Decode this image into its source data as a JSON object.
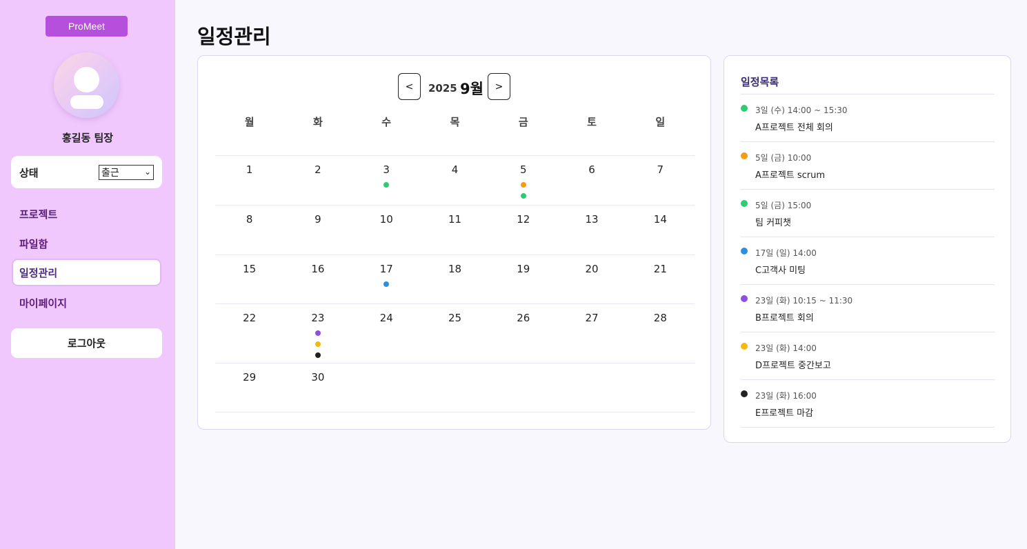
{
  "app": {
    "brand": "ProMeet"
  },
  "sidebar": {
    "user_name": "홍길동 팀장",
    "status": {
      "label": "상태",
      "selected": "출근"
    },
    "nav": [
      {
        "label": "프로젝트",
        "active": false
      },
      {
        "label": "파일함",
        "active": false
      },
      {
        "label": "일정관리",
        "active": true
      },
      {
        "label": "마이페이지",
        "active": false
      }
    ],
    "logout_label": "로그아웃"
  },
  "page": {
    "title": "일정관리"
  },
  "calendar": {
    "prev_label": "<",
    "next_label": ">",
    "year": "2025",
    "month": "9월",
    "weekdays": [
      "월",
      "화",
      "수",
      "목",
      "금",
      "토",
      "일"
    ],
    "weeks": [
      [
        {
          "day": "1",
          "dots": []
        },
        {
          "day": "2",
          "dots": []
        },
        {
          "day": "3",
          "dots": [
            "#2ecc71"
          ]
        },
        {
          "day": "4",
          "dots": []
        },
        {
          "day": "5",
          "dots": [
            "#f39c12",
            "#2ecc71"
          ]
        },
        {
          "day": "6",
          "dots": []
        },
        {
          "day": "7",
          "dots": []
        }
      ],
      [
        {
          "day": "8",
          "dots": []
        },
        {
          "day": "9",
          "dots": []
        },
        {
          "day": "10",
          "dots": []
        },
        {
          "day": "11",
          "dots": []
        },
        {
          "day": "12",
          "dots": []
        },
        {
          "day": "13",
          "dots": []
        },
        {
          "day": "14",
          "dots": []
        }
      ],
      [
        {
          "day": "15",
          "dots": []
        },
        {
          "day": "16",
          "dots": []
        },
        {
          "day": "17",
          "dots": [
            "#2d8fe0"
          ]
        },
        {
          "day": "18",
          "dots": []
        },
        {
          "day": "19",
          "dots": []
        },
        {
          "day": "20",
          "dots": []
        },
        {
          "day": "21",
          "dots": []
        }
      ],
      [
        {
          "day": "22",
          "dots": []
        },
        {
          "day": "23",
          "dots": [
            "#8e4fe0",
            "#f5b80c",
            "#222222"
          ]
        },
        {
          "day": "24",
          "dots": []
        },
        {
          "day": "25",
          "dots": []
        },
        {
          "day": "26",
          "dots": []
        },
        {
          "day": "27",
          "dots": []
        },
        {
          "day": "28",
          "dots": []
        }
      ],
      [
        {
          "day": "29",
          "dots": []
        },
        {
          "day": "30",
          "dots": []
        },
        {
          "day": "",
          "dots": []
        },
        {
          "day": "",
          "dots": []
        },
        {
          "day": "",
          "dots": []
        },
        {
          "day": "",
          "dots": []
        },
        {
          "day": "",
          "dots": []
        }
      ]
    ]
  },
  "schedule_list": {
    "title": "일정목록",
    "events": [
      {
        "time": "3일 (수) 14:00 ~ 15:30",
        "name": "A프로젝트 전체 회의",
        "color": "#2ecc71"
      },
      {
        "time": "5일 (금) 10:00",
        "name": "A프로젝트 scrum",
        "color": "#f39c12"
      },
      {
        "time": "5일 (금) 15:00",
        "name": "팀 커피챗",
        "color": "#2ecc71"
      },
      {
        "time": "17일 (일) 14:00",
        "name": "C고객사 미팅",
        "color": "#2d8fe0"
      },
      {
        "time": "23일 (화) 10:15 ~ 11:30",
        "name": "B프로젝트 회의",
        "color": "#8e4fe0"
      },
      {
        "time": "23일 (화) 14:00",
        "name": "D프로젝트 중간보고",
        "color": "#f5b80c"
      },
      {
        "time": "23일 (화) 16:00",
        "name": "E프로젝트 마감",
        "color": "#222222"
      }
    ]
  }
}
